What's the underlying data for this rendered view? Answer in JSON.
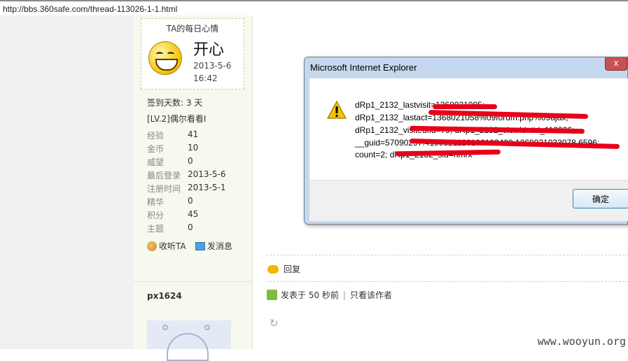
{
  "browser": {
    "url": "http://bbs.360safe.com/thread-113026-1-1.html"
  },
  "profile": {
    "mood_title": "TA的每日心情",
    "mood_word": "开心",
    "mood_date": "2013-5-6",
    "mood_time": "16:42",
    "checkin": "签到天数: 3 天",
    "level": "[LV.2]偶尔看看I",
    "stats": [
      {
        "label": "经验",
        "value": "41"
      },
      {
        "label": "金币",
        "value": "10"
      },
      {
        "label": "威望",
        "value": "0"
      },
      {
        "label": "最后登录",
        "value": "2013-5-6"
      },
      {
        "label": "注册时间",
        "value": "2013-5-1"
      },
      {
        "label": "精华",
        "value": "0"
      },
      {
        "label": "积分",
        "value": "45"
      },
      {
        "label": "主题",
        "value": "0"
      }
    ],
    "follow_label": "收听TA",
    "message_label": "发消息",
    "next_username": "px1624"
  },
  "post": {
    "reply_label": "回复",
    "posted_text": "发表于 50 秒前",
    "separator": "|",
    "author_only": "只看该作者"
  },
  "dialog": {
    "title": "Microsoft Internet Explorer",
    "close_glyph": "x",
    "lines": [
      "dRp1_2132_lastvisit=1368021995;",
      "dRp1_2132_lastact=1368021058%09forum.php%09ajax;",
      "dRp1_2132_visitedfid=79; dRp1_2132_viewid=tid_113026;",
      "__guid=57090297.4199321126106102400.1368021033078.6596;",
      "count=2; dRp1_2132_sid=nmrx"
    ],
    "ok_label": "确定"
  },
  "watermark": "www.wooyun.org"
}
